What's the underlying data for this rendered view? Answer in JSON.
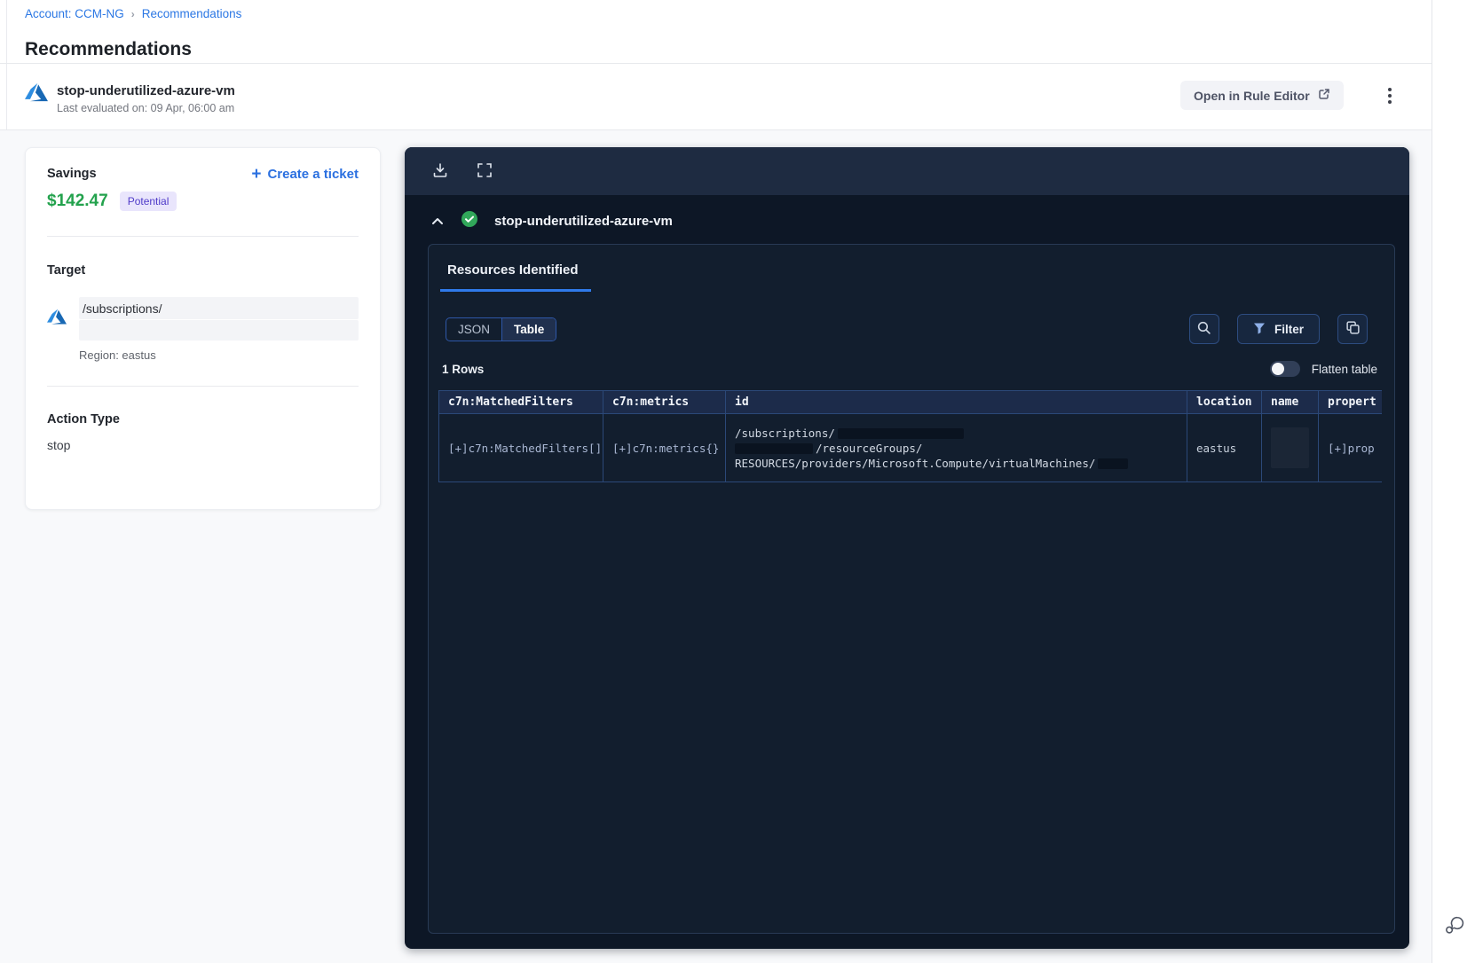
{
  "breadcrumb": {
    "account_link": "Account: CCM-NG",
    "separator": "›",
    "current": "Recommendations"
  },
  "page": {
    "title": "Recommendations"
  },
  "rule_header": {
    "name": "stop-underutilized-azure-vm",
    "last_evaluated": "Last evaluated on: 09 Apr, 06:00 am",
    "open_rule_editor_label": "Open in Rule Editor"
  },
  "summary_card": {
    "savings_label": "Savings",
    "savings_amount": "$142.47",
    "savings_badge": "Potential",
    "create_ticket_plus": "+",
    "create_ticket_label": "Create a ticket",
    "target_label": "Target",
    "target_path": "/subscriptions/",
    "target_region": "Region: eastus",
    "action_type_label": "Action Type",
    "action_type_value": "stop"
  },
  "results_panel": {
    "rule_name": "stop-underutilized-azure-vm",
    "tab_label": "Resources Identified",
    "view_toggle": {
      "json_label": "JSON",
      "table_label": "Table",
      "selected": "Table"
    },
    "filter_button_label": "Filter",
    "rows_count": "1 Rows",
    "flatten_toggle_label": "Flatten table",
    "flatten_enabled": false,
    "table": {
      "columns": [
        "c7n:MatchedFilters",
        "c7n:metrics",
        "id",
        "location",
        "name",
        "propert"
      ],
      "rows": [
        {
          "matched_filters": "[+]c7n:MatchedFilters[]",
          "metrics": "[+]c7n:metrics{}",
          "id_line_1": "/subscriptions/",
          "id_line_2": "/resourceGroups/",
          "id_line_3": "RESOURCES/providers/Microsoft.Compute/virtualMachines/",
          "location": "eastus",
          "name": "",
          "properties": "[+]prop"
        }
      ]
    }
  },
  "colors": {
    "accent_blue": "#2b77e4",
    "savings_green": "#23a24d",
    "badge_purple_bg": "#e9e5fc",
    "badge_purple_text": "#4f3bc9",
    "panel_bg": "#0d1726",
    "panel_topbar": "#1e2b41",
    "panel_card_bg": "#121e2e",
    "table_border": "#2b4878",
    "tab_underline": "#2f7aea",
    "success_green": "#31a75a"
  }
}
